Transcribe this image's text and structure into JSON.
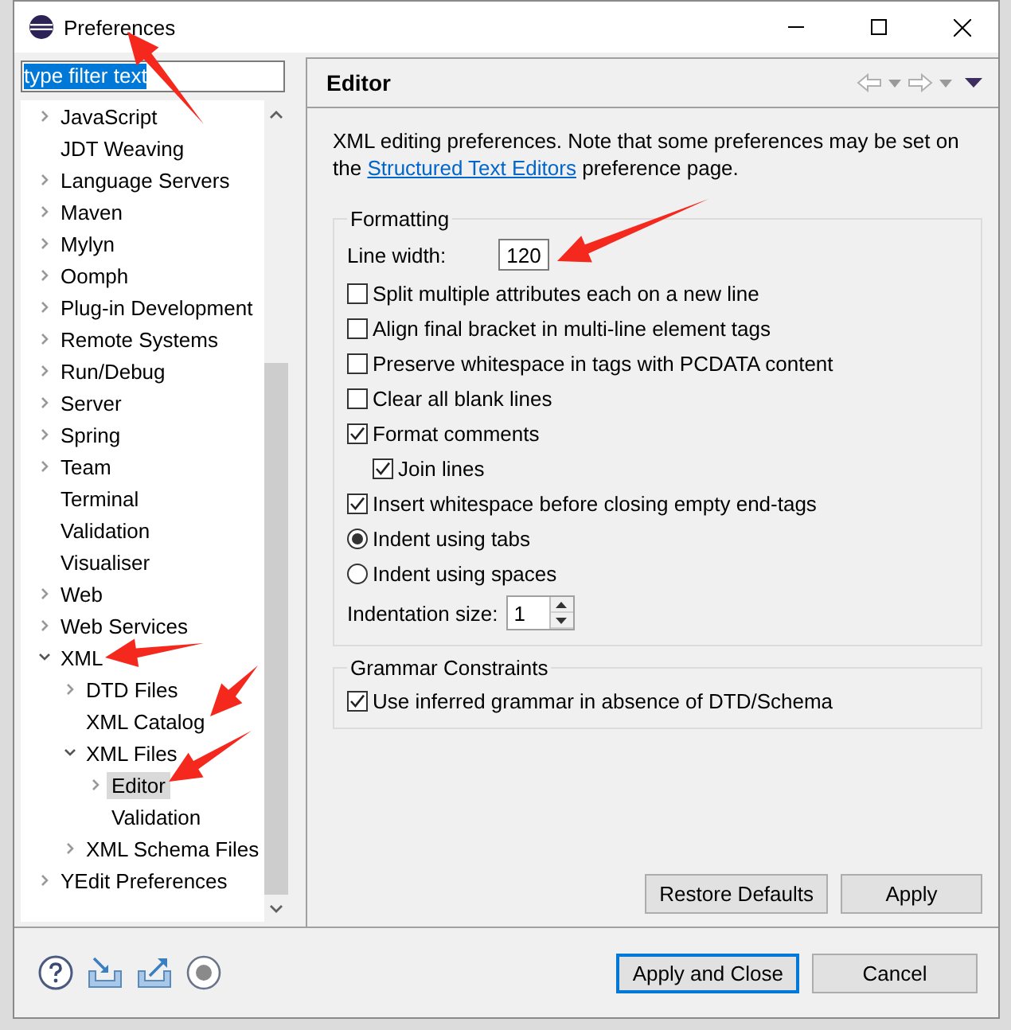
{
  "window": {
    "title": "Preferences"
  },
  "filter": {
    "value": "type filter text",
    "selected": true
  },
  "tree": [
    {
      "label": "JavaScript",
      "expandable": true,
      "expanded": false,
      "selected": false
    },
    {
      "label": "JDT Weaving",
      "expandable": false,
      "selected": false
    },
    {
      "label": "Language Servers",
      "expandable": true,
      "expanded": false,
      "selected": false
    },
    {
      "label": "Maven",
      "expandable": true,
      "expanded": false,
      "selected": false
    },
    {
      "label": "Mylyn",
      "expandable": true,
      "expanded": false,
      "selected": false
    },
    {
      "label": "Oomph",
      "expandable": true,
      "expanded": false,
      "selected": false
    },
    {
      "label": "Plug-in Development",
      "expandable": true,
      "expanded": false,
      "selected": false
    },
    {
      "label": "Remote Systems",
      "expandable": true,
      "expanded": false,
      "selected": false
    },
    {
      "label": "Run/Debug",
      "expandable": true,
      "expanded": false,
      "selected": false
    },
    {
      "label": "Server",
      "expandable": true,
      "expanded": false,
      "selected": false
    },
    {
      "label": "Spring",
      "expandable": true,
      "expanded": false,
      "selected": false
    },
    {
      "label": "Team",
      "expandable": true,
      "expanded": false,
      "selected": false
    },
    {
      "label": "Terminal",
      "expandable": false,
      "selected": false
    },
    {
      "label": "Validation",
      "expandable": false,
      "selected": false
    },
    {
      "label": "Visualiser",
      "expandable": false,
      "selected": false
    },
    {
      "label": "Web",
      "expandable": true,
      "expanded": false,
      "selected": false
    },
    {
      "label": "Web Services",
      "expandable": true,
      "expanded": false,
      "selected": false
    },
    {
      "label": "XML",
      "expandable": true,
      "expanded": true,
      "selected": false,
      "children": [
        {
          "label": "DTD Files",
          "expandable": true,
          "expanded": false,
          "selected": false
        },
        {
          "label": "XML Catalog",
          "expandable": false,
          "selected": false
        },
        {
          "label": "XML Files",
          "expandable": true,
          "expanded": true,
          "selected": false,
          "children": [
            {
              "label": "Editor",
              "expandable": true,
              "expanded": false,
              "selected": true
            },
            {
              "label": "Validation",
              "expandable": false,
              "selected": false
            }
          ]
        },
        {
          "label": "XML Schema Files",
          "expandable": true,
          "expanded": false,
          "selected": false
        }
      ]
    },
    {
      "label": "YEdit Preferences",
      "expandable": true,
      "expanded": false,
      "selected": false
    }
  ],
  "page": {
    "title": "Editor",
    "description": {
      "before": "XML editing preferences.  Note that some preferences may be set on the",
      "link": "Structured Text Editors",
      "after": "preference page."
    },
    "groups": [
      {
        "title": "Formatting",
        "items": [
          {
            "kind": "number",
            "label": "Line width:",
            "value": "120"
          },
          {
            "kind": "checkbox",
            "label": "Split multiple attributes each on a new line",
            "checked": false,
            "indented": false
          },
          {
            "kind": "checkbox",
            "label": "Align final bracket in multi-line element tags",
            "checked": false,
            "indented": false
          },
          {
            "kind": "checkbox",
            "label": "Preserve whitespace in tags with PCDATA content",
            "checked": false,
            "indented": false
          },
          {
            "kind": "checkbox",
            "label": "Clear all blank lines",
            "checked": false,
            "indented": false
          },
          {
            "kind": "checkbox",
            "label": "Format comments",
            "checked": true,
            "indented": false
          },
          {
            "kind": "checkbox",
            "label": "Join lines",
            "checked": true,
            "indented": true
          },
          {
            "kind": "checkbox",
            "label": "Insert whitespace before closing empty end-tags",
            "checked": true,
            "indented": false
          },
          {
            "kind": "radio",
            "label": "Indent using tabs",
            "selected": true
          },
          {
            "kind": "radio",
            "label": "Indent using spaces",
            "selected": false
          },
          {
            "kind": "spinner",
            "label": "Indentation size:",
            "value": "1"
          }
        ]
      },
      {
        "title": "Grammar Constraints",
        "items": [
          {
            "kind": "checkbox",
            "label": "Use inferred grammar in absence of DTD/Schema",
            "checked": true,
            "indented": false
          }
        ]
      }
    ],
    "buttons": [
      "Restore Defaults",
      "Apply"
    ]
  },
  "footer": {
    "buttons": [
      {
        "label": "Apply and Close",
        "default": true
      },
      {
        "label": "Cancel",
        "default": false
      }
    ]
  }
}
